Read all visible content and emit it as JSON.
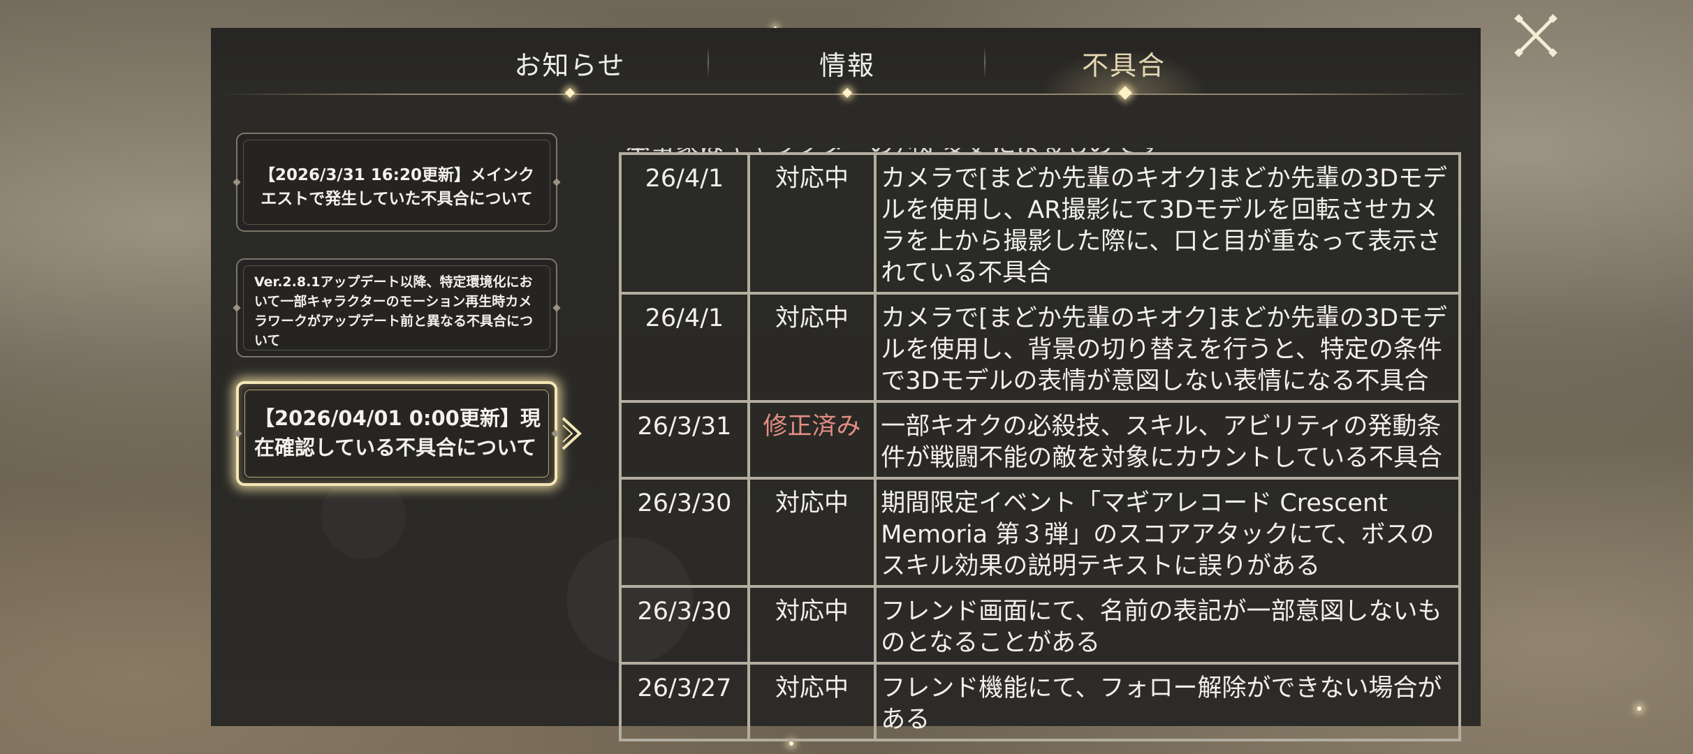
{
  "tabs": [
    {
      "label": "お知らせ"
    },
    {
      "label": "情報"
    },
    {
      "label": "不具合",
      "active": true
    }
  ],
  "notices": [
    {
      "title": "【2026/3/31 16:20更新】メインクエストで発生していた不具合について"
    },
    {
      "title": "Ver.2.8.1アップデート以降、特定環境化において一部キャラクターのモーション再生時カメラワークがアップデート前と異なる不具合について"
    },
    {
      "title": "【2026/04/01 0:00更新】現在確認している不具合について",
      "selected": true
    }
  ],
  "table": {
    "cutoff_text": "本事象はキャラクターの判定変更によるものです",
    "rows": [
      {
        "date": "26/4/1",
        "status": "対応中",
        "desc": "カメラで[まどか先輩のキオク]まどか先輩の3Dモデルを使用し、AR撮影にて3Dモデルを回転させカメラを上から撮影した際に、口と目が重なって表示されている不具合"
      },
      {
        "date": "26/4/1",
        "status": "対応中",
        "desc": "カメラで[まどか先輩のキオク]まどか先輩の3Dモデルを使用し、背景の切り替えを行うと、特定の条件で3Dモデルの表情が意図しない表情になる不具合"
      },
      {
        "date": "26/3/31",
        "status": "修正済み",
        "desc": "一部キオクの必殺技、スキル、アビリティの発動条件が戦闘不能の敵を対象にカウントしている不具合"
      },
      {
        "date": "26/3/30",
        "status": "対応中",
        "desc": "期間限定イベント「マギアレコード Crescent Memoria 第３弾」のスコアアタックにて、ボスのスキル効果の説明テキストに誤りがある"
      },
      {
        "date": "26/3/30",
        "status": "対応中",
        "desc": "フレンド画面にて、名前の表記が一部意図しないものとなることがある"
      },
      {
        "date": "26/3/27",
        "status": "対応中",
        "desc": "フレンド機能にて、フォロー解除ができない場合がある"
      }
    ]
  },
  "colors": {
    "accent_gold": "#f4e7b4",
    "status_fixed": "#e38d82",
    "panel_bg": "#2b2a27"
  },
  "icons": {
    "close": "close-x-icon",
    "selected_arrow": "chevron-right-icon"
  }
}
